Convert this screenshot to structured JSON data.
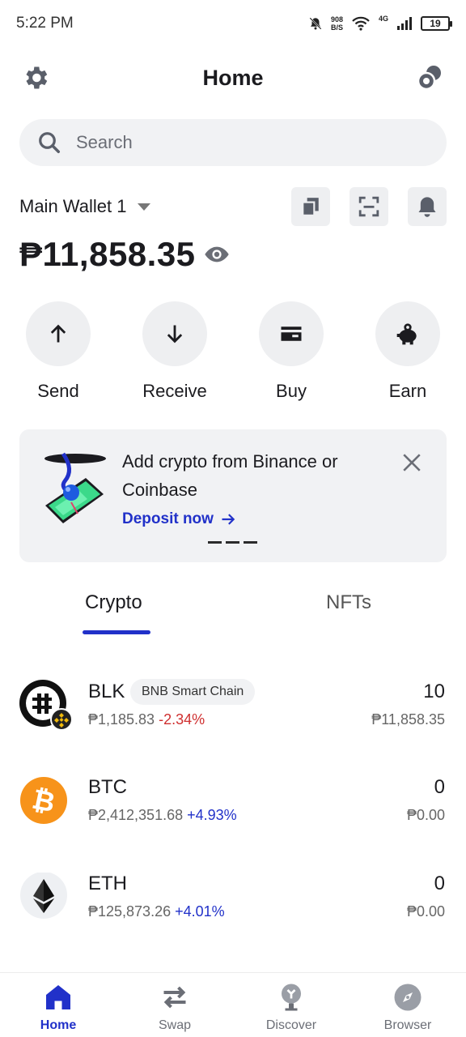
{
  "status_bar": {
    "time": "5:22 PM",
    "speed_value": "908",
    "speed_unit": "B/S",
    "network": "4G",
    "battery": "19"
  },
  "header": {
    "title": "Home",
    "settings_icon": "gear-icon",
    "right_icon": "coins-icon"
  },
  "search": {
    "placeholder": "Search"
  },
  "wallet": {
    "name": "Main Wallet 1",
    "balance": "₱11,858.35",
    "actions_icons": [
      "copy-icon",
      "scan-icon",
      "bell-icon"
    ]
  },
  "actions": [
    {
      "label": "Send",
      "icon": "arrow-up-icon"
    },
    {
      "label": "Receive",
      "icon": "arrow-down-icon"
    },
    {
      "label": "Buy",
      "icon": "card-icon"
    },
    {
      "label": "Earn",
      "icon": "piggy-bank-icon"
    }
  ],
  "banner": {
    "text": "Add crypto from Binance or Coinbase",
    "link": "Deposit now"
  },
  "tabs": [
    {
      "label": "Crypto",
      "active": true
    },
    {
      "label": "NFTs",
      "active": false
    }
  ],
  "assets": [
    {
      "symbol": "BLK",
      "chain": "BNB Smart Chain",
      "price": "₱1,185.83",
      "change": "-2.34%",
      "amount": "10",
      "value": "₱11,858.35"
    },
    {
      "symbol": "BTC",
      "chain": "",
      "price": "₱2,412,351.68",
      "change": "+4.93%",
      "amount": "0",
      "value": "₱0.00"
    },
    {
      "symbol": "ETH",
      "chain": "",
      "price": "₱125,873.26",
      "change": "+4.01%",
      "amount": "0",
      "value": "₱0.00"
    }
  ],
  "bottom_nav": [
    {
      "label": "Home",
      "active": true
    },
    {
      "label": "Swap",
      "active": false
    },
    {
      "label": "Discover",
      "active": false
    },
    {
      "label": "Browser",
      "active": false
    }
  ],
  "colors": {
    "accent": "#2131c9",
    "negative": "#cf2f2f",
    "btc": "#f7931a"
  }
}
